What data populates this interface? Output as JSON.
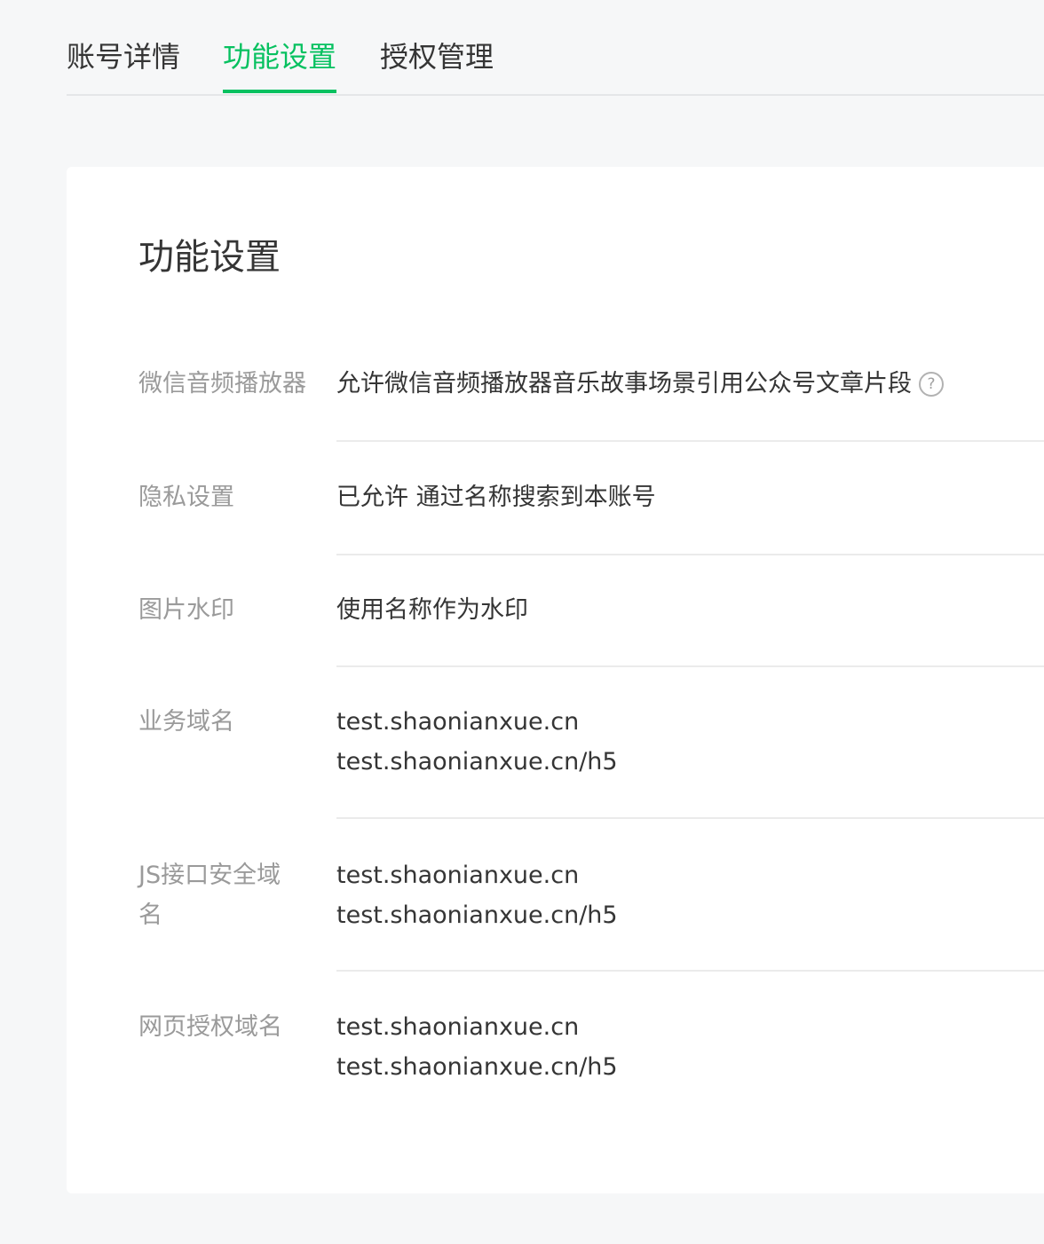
{
  "tabs": [
    {
      "label": "账号详情",
      "active": false
    },
    {
      "label": "功能设置",
      "active": true
    },
    {
      "label": "授权管理",
      "active": false
    }
  ],
  "accent_color": "#07c160",
  "card": {
    "title": "功能设置",
    "rows": [
      {
        "label": "微信音频播放器",
        "values": [
          "允许微信音频播放器音乐故事场景引用公众号文章片段"
        ],
        "icon": "help-circle-icon"
      },
      {
        "label": "隐私设置",
        "values": [
          "已允许 通过名称搜索到本账号"
        ]
      },
      {
        "label": "图片水印",
        "values": [
          "使用名称作为水印"
        ]
      },
      {
        "label": "业务域名",
        "values": [
          "test.shaonianxue.cn",
          "test.shaonianxue.cn/h5"
        ]
      },
      {
        "label_lines": [
          "JS接口安全域",
          "名"
        ],
        "values": [
          "test.shaonianxue.cn",
          "test.shaonianxue.cn/h5"
        ]
      },
      {
        "label": "网页授权域名",
        "values": [
          "test.shaonianxue.cn",
          "test.shaonianxue.cn/h5"
        ]
      }
    ],
    "help_icon_glyph": "?"
  }
}
